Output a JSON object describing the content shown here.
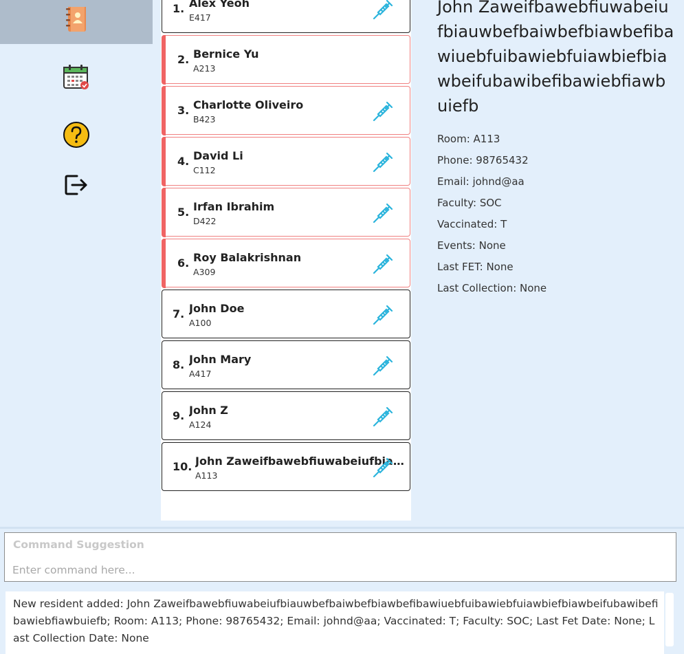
{
  "sidebar": {
    "items": [
      {
        "icon": "address-book-icon",
        "active": true
      },
      {
        "icon": "calendar-icon",
        "active": false
      },
      {
        "icon": "help-icon",
        "active": false
      },
      {
        "icon": "exit-icon",
        "active": false
      }
    ]
  },
  "residents": [
    {
      "index": "1.",
      "name": "Alex Yeoh",
      "room": "E417",
      "flagged": false,
      "vaccinated": true
    },
    {
      "index": "2.",
      "name": "Bernice Yu",
      "room": "A213",
      "flagged": true,
      "vaccinated": false
    },
    {
      "index": "3.",
      "name": "Charlotte Oliveiro",
      "room": "B423",
      "flagged": true,
      "vaccinated": true
    },
    {
      "index": "4.",
      "name": "David Li",
      "room": "C112",
      "flagged": true,
      "vaccinated": true
    },
    {
      "index": "5.",
      "name": "Irfan Ibrahim",
      "room": "D422",
      "flagged": true,
      "vaccinated": true
    },
    {
      "index": "6.",
      "name": "Roy Balakrishnan",
      "room": "A309",
      "flagged": true,
      "vaccinated": true
    },
    {
      "index": "7.",
      "name": "John Doe",
      "room": "A100",
      "flagged": false,
      "vaccinated": true
    },
    {
      "index": "8.",
      "name": "John Mary",
      "room": "A417",
      "flagged": false,
      "vaccinated": true
    },
    {
      "index": "9.",
      "name": "John Z",
      "room": "A124",
      "flagged": false,
      "vaccinated": true
    },
    {
      "index": "10.",
      "name": "John Zaweifbawebfiuwabeiufbiauwbe...",
      "room": "A113",
      "flagged": false,
      "vaccinated": true
    }
  ],
  "detail": {
    "name": "John Zaweifbawebfiuwabeiufbiauwbefbaiwbefbiawbefibawiuebfuibawiebfuiawbiefbiawbeifubawibefibawiebfiawbuiefb",
    "room": "Room: A113",
    "phone": "Phone: 98765432",
    "email": "Email: johnd@aa",
    "faculty": "Faculty: SOC",
    "vaccinated": "Vaccinated: T",
    "events": "Events: None",
    "last_fet": "Last FET: None",
    "last_collection": "Last Collection: None"
  },
  "command": {
    "suggestion_placeholder": "Command Suggestion",
    "input_placeholder": "Enter command here...",
    "input_value": ""
  },
  "result": {
    "text": "New resident added: John Zaweifbawebfiuwabeiufbiauwbefbaiwbefbiawbefibawiuebfuibawiebfuiawbiefbiawbeifubawibefibawiebfiawbuiefb; Room: A113; Phone: 98765432; Email: johnd@aa; Vaccinated: T; Faculty: SOC; Last Fet Date: None; Last Collection Date: None"
  },
  "colors": {
    "background": "#e3effb",
    "sidebar_active": "#aebccb",
    "flag_red": "#f06464",
    "syringe": "#2bb4dc"
  }
}
